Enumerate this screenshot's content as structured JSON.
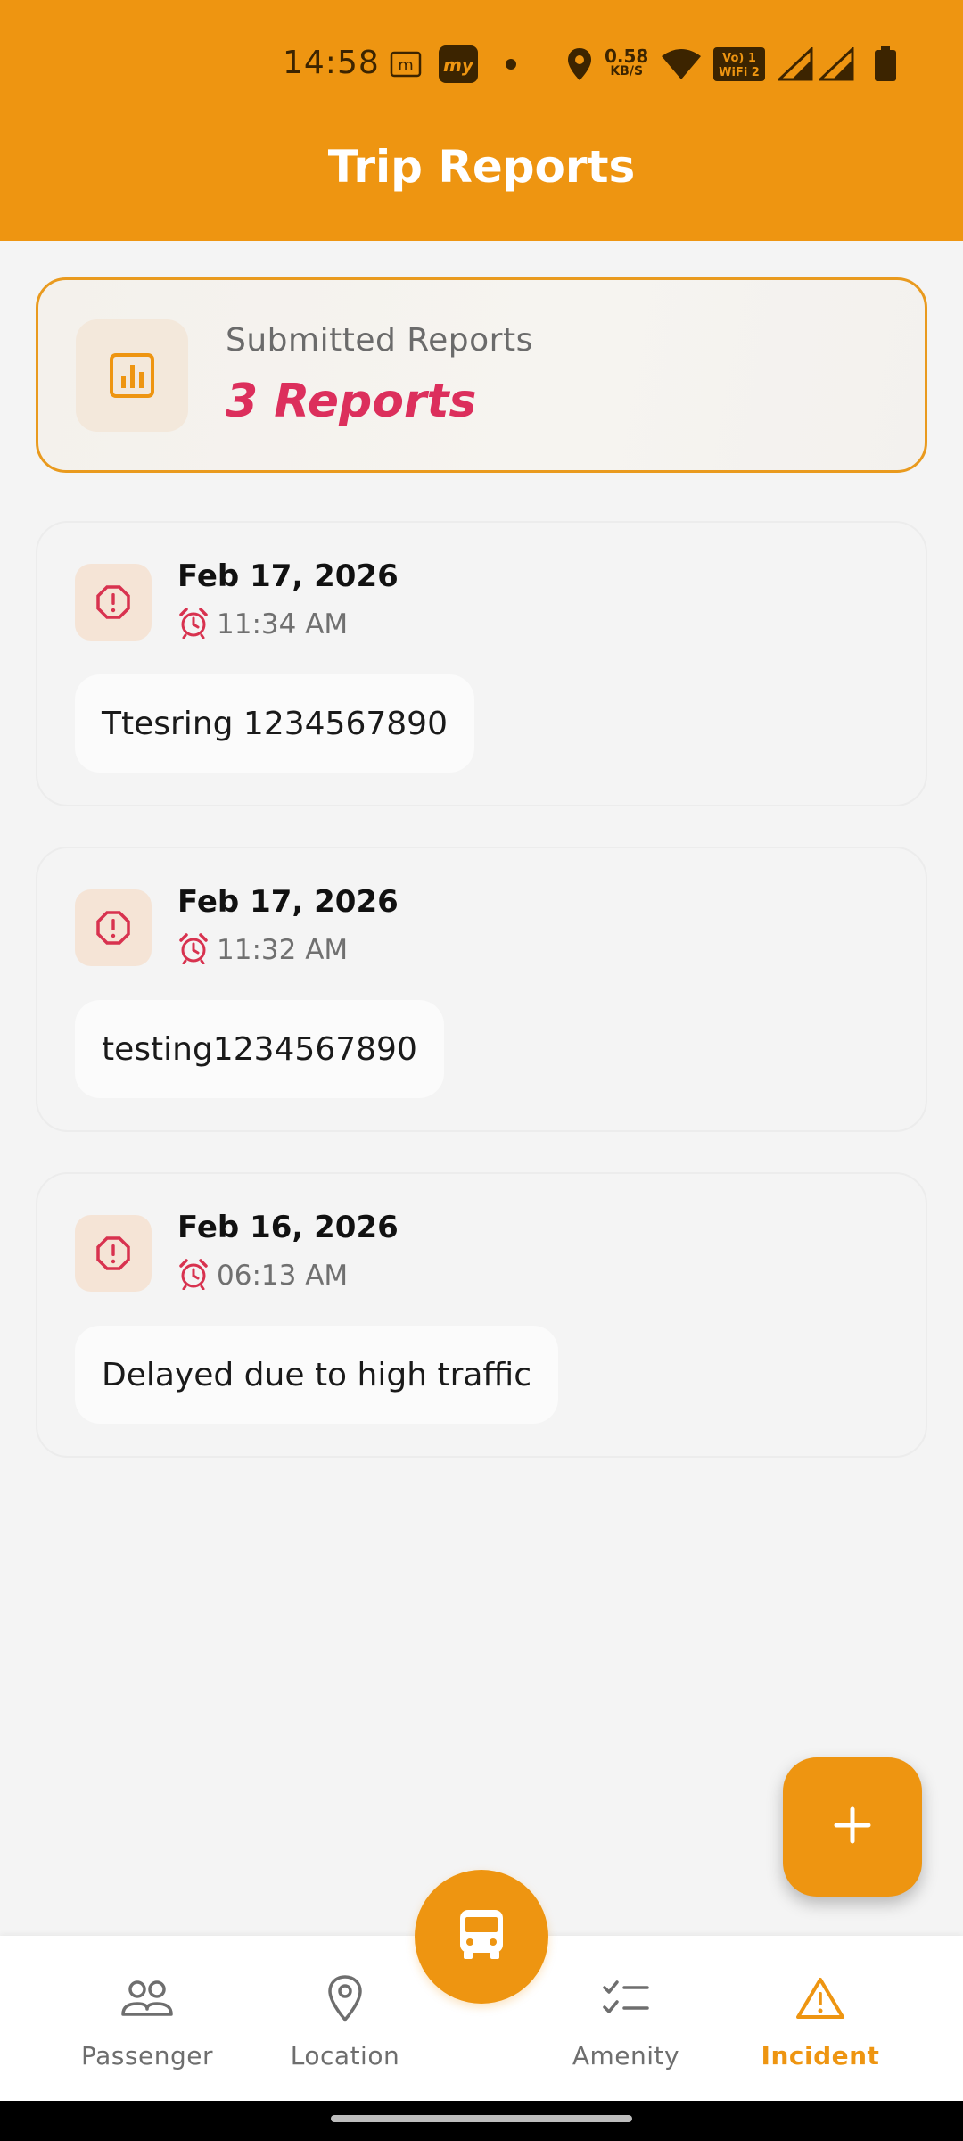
{
  "status_bar": {
    "time": "14:58",
    "net_speed_value": "0.58",
    "net_speed_unit": "KB/S",
    "volte_label": "VoLTE",
    "wifi_label": "WiFi 2"
  },
  "header": {
    "title": "Trip Reports"
  },
  "summary": {
    "label": "Submitted Reports",
    "count_text": "3 Reports"
  },
  "reports": [
    {
      "date": "Feb 17, 2026",
      "time": "11:34 AM",
      "text": "Ttesring 1234567890"
    },
    {
      "date": "Feb 17, 2026",
      "time": "11:32 AM",
      "text": "testing1234567890"
    },
    {
      "date": "Feb 16, 2026",
      "time": "06:13 AM",
      "text": "Delayed due to high traffic"
    }
  ],
  "fab": {
    "icon": "plus-icon"
  },
  "bottom_nav": {
    "items": [
      {
        "label": "Passenger",
        "icon": "passenger-icon",
        "active": false
      },
      {
        "label": "Location",
        "icon": "location-pin-icon",
        "active": false
      },
      {
        "label": "Amenity",
        "icon": "checklist-icon",
        "active": false
      },
      {
        "label": "Incident",
        "icon": "warning-triangle-icon",
        "active": true
      }
    ],
    "center_icon": "bus-icon"
  },
  "colors": {
    "accent": "#ee9511",
    "count_pink": "#dc2f5c",
    "alert_red": "#d8324f",
    "background": "#f4f4f4"
  }
}
